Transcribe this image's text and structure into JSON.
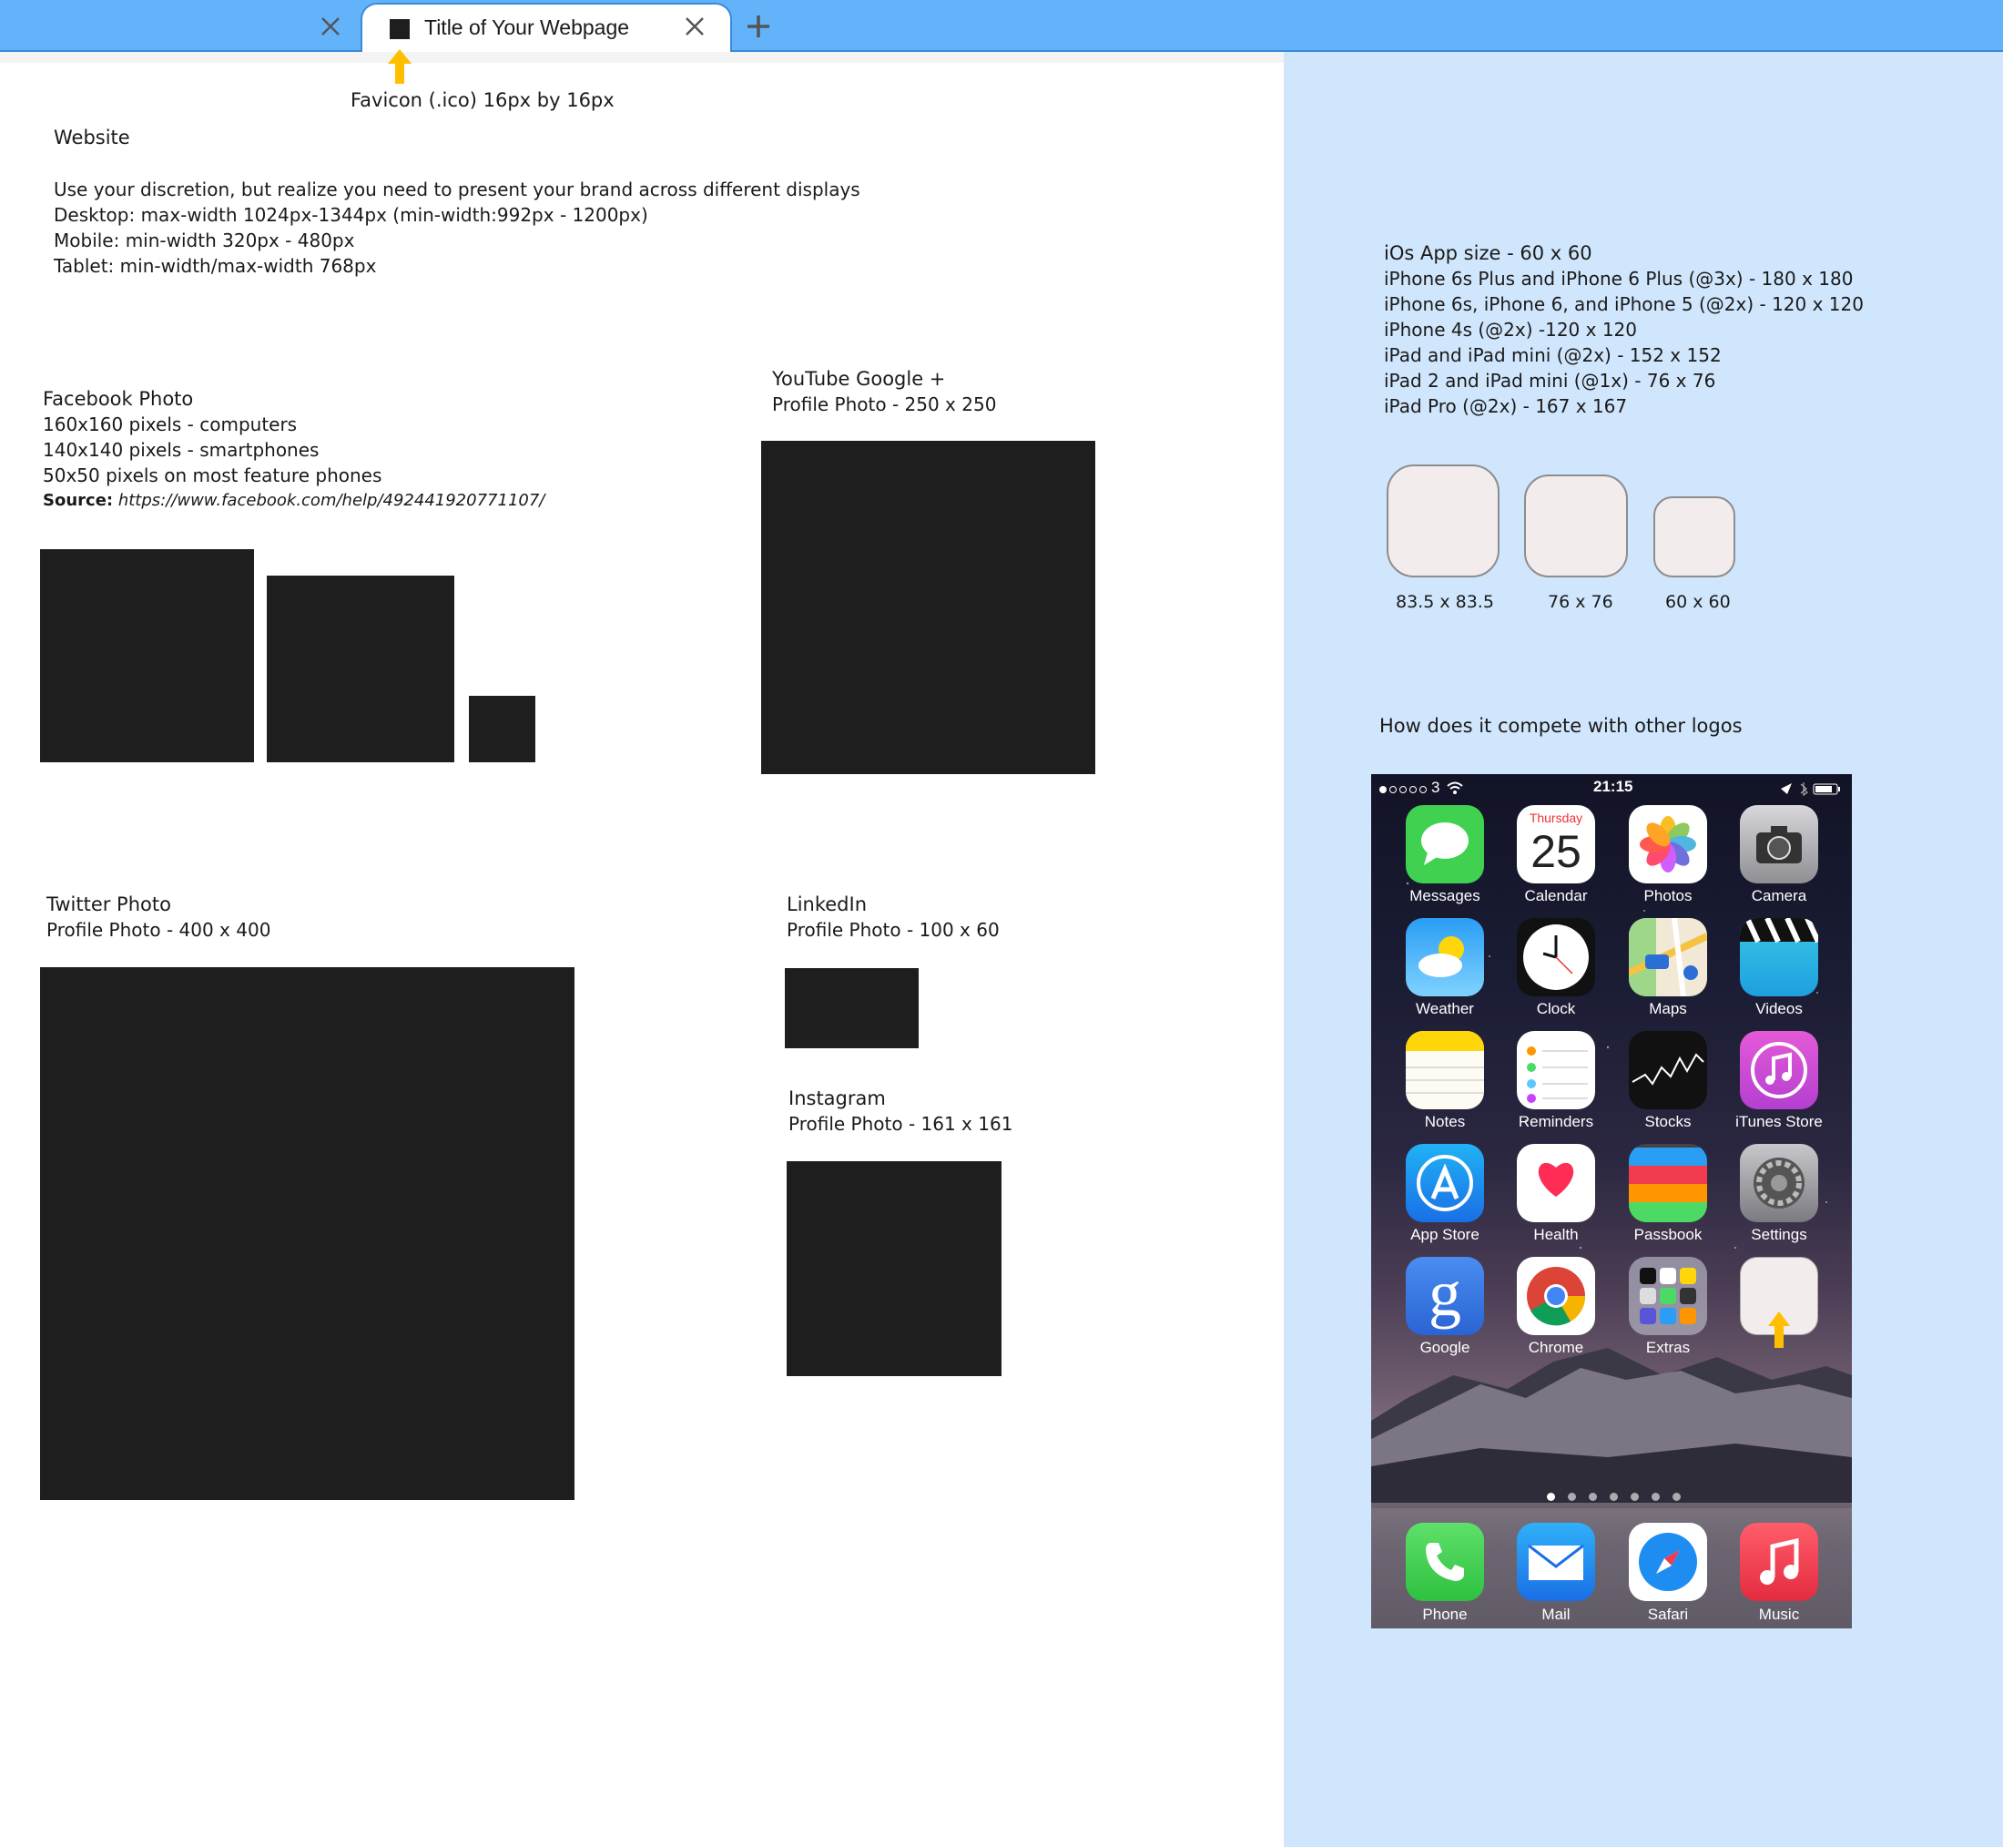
{
  "browser": {
    "tab_title": "Title of Your Webpage",
    "favicon_note": "Favicon (.ico) 16px  by 16px"
  },
  "website": {
    "heading": "Website",
    "lines": [
      "Use your discretion, but realize you need to present your brand across different displays",
      "Desktop: max-width 1024px-1344px (min-width:992px - 1200px)",
      "Mobile: min-width 320px - 480px",
      "Tablet: min-width/max-width 768px"
    ]
  },
  "facebook": {
    "heading": "Facebook Photo",
    "lines": [
      "160x160 pixels - computers",
      "140x140 pixels - smartphones",
      "50x50 pixels on most feature phones"
    ],
    "source_label": "Source:",
    "source_url": "https://www.facebook.com/help/492441920771107/"
  },
  "youtube": {
    "heading": "YouTube Google +",
    "sub": "Profile Photo - 250 x 250"
  },
  "twitter": {
    "heading": "Twitter Photo",
    "sub": "Profile Photo - 400 x 400"
  },
  "linkedin": {
    "heading": "LinkedIn",
    "sub": "Profile Photo - 100 x 60"
  },
  "instagram": {
    "heading": "Instagram",
    "sub": "Profile Photo - 161 x 161"
  },
  "ios": {
    "heading": "iOs App size - 60 x 60",
    "lines": [
      "iPhone 6s Plus and iPhone 6 Plus (@3x) - 180 x 180",
      "iPhone 6s, iPhone 6, and iPhone 5 (@2x) - 120 x 120",
      "iPhone 4s (@2x) -120 x 120",
      "iPad and iPad mini (@2x) - 152 x 152",
      "iPad 2 and iPad mini (@1x) - 76 x 76",
      "iPad Pro (@2x) - 167 x 167"
    ],
    "tile_labels": [
      "83.5 x 83.5",
      "76 x 76",
      "60 x 60"
    ],
    "compete_heading": "How does it compete with other logos"
  },
  "phone": {
    "carrier": "3",
    "time": "21:15",
    "calendar_day": "Thursday",
    "calendar_date": "25",
    "apps": [
      {
        "label": "Messages",
        "color": "#3fd14f"
      },
      {
        "label": "Calendar",
        "color": "#ffffff"
      },
      {
        "label": "Photos",
        "color": "#ffffff"
      },
      {
        "label": "Camera",
        "color": "#8e8e93"
      },
      {
        "label": "Weather",
        "color": "#2a9df4"
      },
      {
        "label": "Clock",
        "color": "#111111"
      },
      {
        "label": "Maps",
        "color": "#f1e9d5"
      },
      {
        "label": "Videos",
        "color": "#38c8e6"
      },
      {
        "label": "Notes",
        "color": "#fdfbf2"
      },
      {
        "label": "Reminders",
        "color": "#ffffff"
      },
      {
        "label": "Stocks",
        "color": "#111111"
      },
      {
        "label": "iTunes Store",
        "color": "#d84bd9"
      },
      {
        "label": "App Store",
        "color": "#1d8df2"
      },
      {
        "label": "Health",
        "color": "#ffffff"
      },
      {
        "label": "Passbook",
        "color": "#4a4a4a"
      },
      {
        "label": "Settings",
        "color": "#8e8e93"
      },
      {
        "label": "Google",
        "color": "#3a7be8"
      },
      {
        "label": "Chrome",
        "color": "#ffffff"
      },
      {
        "label": "Extras",
        "color": "#9a9aa6"
      }
    ],
    "dock": [
      {
        "label": "Phone",
        "color": "#3fd14f"
      },
      {
        "label": "Mail",
        "color": "#2a8af4"
      },
      {
        "label": "Safari",
        "color": "#ffffff"
      },
      {
        "label": "Music",
        "color": "#f23b4f"
      }
    ]
  }
}
